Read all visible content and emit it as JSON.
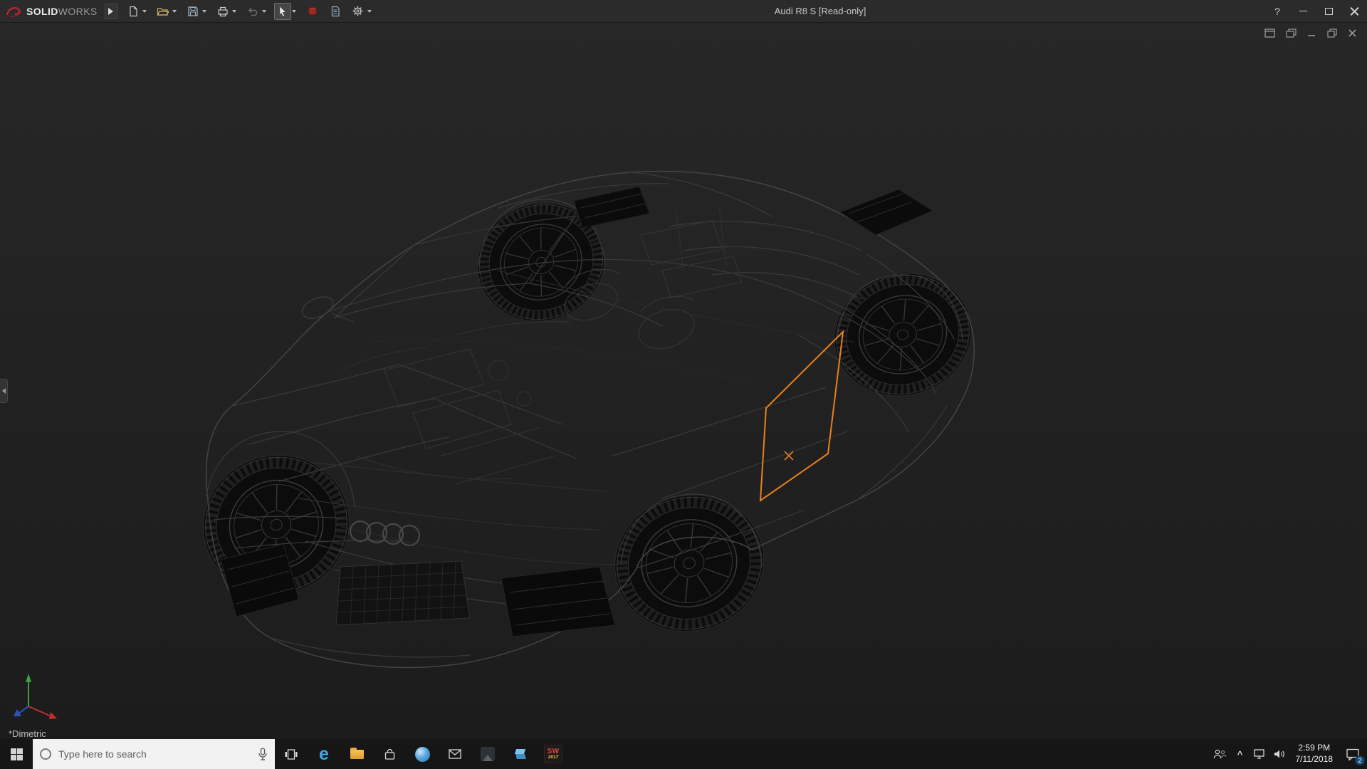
{
  "titlebar": {
    "brand": {
      "solid": "SOLID",
      "works": "WORKS"
    },
    "title": "Audi R8 S [Read-only]",
    "help_glyph": "?",
    "tools": [
      "flyout",
      "new-document",
      "open",
      "save",
      "print",
      "undo",
      "select",
      "rebuild",
      "file-properties",
      "options"
    ],
    "window_controls": [
      "help",
      "minimize",
      "maximize",
      "close"
    ]
  },
  "viewport": {
    "view_label": "*Dimetric",
    "document_controls": [
      "new-window",
      "cascade",
      "minimize",
      "restore",
      "close"
    ],
    "selection_color": "#e8811c",
    "model": "Audi R8 wireframe with one face selected (orange)"
  },
  "taskbar": {
    "search_placeholder": "Type here to search",
    "edge_glyph": "e",
    "apps": [
      "start",
      "task-view",
      "edge",
      "file-explorer",
      "store",
      "browser",
      "mail",
      "photos",
      "3d-builder",
      "solidworks"
    ],
    "solidworks_badge": {
      "letters": "SW",
      "year": "2017"
    },
    "tray": {
      "expand_glyph": "^",
      "time": "2:59 PM",
      "date": "7/11/2018",
      "notification_count": "2",
      "icons": [
        "people",
        "hidden-icons",
        "network",
        "volume",
        "clock",
        "action-center"
      ]
    }
  }
}
